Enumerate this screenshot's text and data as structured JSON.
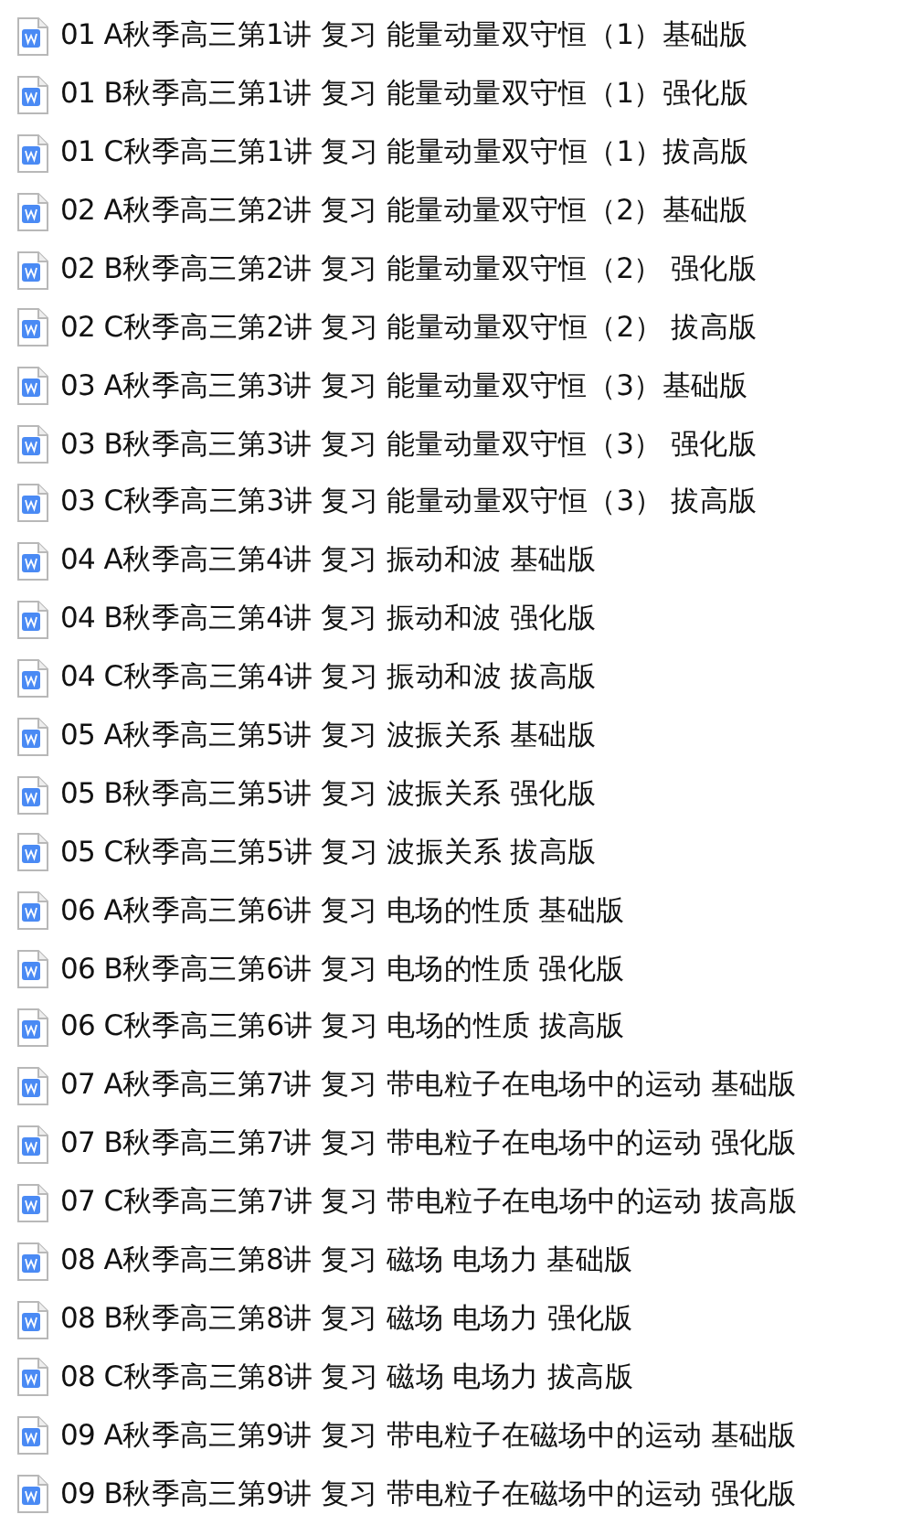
{
  "files": [
    {
      "name": "01 A秋季高三第1讲 复习 能量动量双守恒（1）基础版"
    },
    {
      "name": "01 B秋季高三第1讲 复习 能量动量双守恒（1）强化版"
    },
    {
      "name": "01 C秋季高三第1讲 复习 能量动量双守恒（1）拔高版"
    },
    {
      "name": "02 A秋季高三第2讲 复习 能量动量双守恒（2）基础版"
    },
    {
      "name": "02 B秋季高三第2讲 复习 能量动量双守恒（2） 强化版"
    },
    {
      "name": "02 C秋季高三第2讲 复习 能量动量双守恒（2） 拔高版"
    },
    {
      "name": "03 A秋季高三第3讲 复习 能量动量双守恒（3）基础版"
    },
    {
      "name": "03 B秋季高三第3讲 复习 能量动量双守恒（3） 强化版"
    },
    {
      "name": "03 C秋季高三第3讲 复习 能量动量双守恒（3） 拔高版"
    },
    {
      "name": "04 A秋季高三第4讲 复习 振动和波 基础版"
    },
    {
      "name": "04 B秋季高三第4讲 复习 振动和波 强化版"
    },
    {
      "name": "04 C秋季高三第4讲 复习 振动和波 拔高版"
    },
    {
      "name": "05 A秋季高三第5讲 复习 波振关系 基础版"
    },
    {
      "name": "05 B秋季高三第5讲 复习 波振关系 强化版"
    },
    {
      "name": "05 C秋季高三第5讲 复习 波振关系 拔高版"
    },
    {
      "name": "06 A秋季高三第6讲 复习 电场的性质 基础版"
    },
    {
      "name": "06 B秋季高三第6讲 复习 电场的性质 强化版"
    },
    {
      "name": "06 C秋季高三第6讲 复习 电场的性质 拔高版"
    },
    {
      "name": "07 A秋季高三第7讲 复习 带电粒子在电场中的运动 基础版"
    },
    {
      "name": "07 B秋季高三第7讲 复习 带电粒子在电场中的运动 强化版"
    },
    {
      "name": "07 C秋季高三第7讲 复习 带电粒子在电场中的运动 拔高版"
    },
    {
      "name": "08 A秋季高三第8讲 复习 磁场 电场力 基础版"
    },
    {
      "name": "08 B秋季高三第8讲 复习 磁场 电场力 强化版"
    },
    {
      "name": "08 C秋季高三第8讲 复习 磁场 电场力 拔高版"
    },
    {
      "name": "09 A秋季高三第9讲 复习 带电粒子在磁场中的运动 基础版"
    },
    {
      "name": "09 B秋季高三第9讲 复习 带电粒子在磁场中的运动 强化版"
    }
  ]
}
